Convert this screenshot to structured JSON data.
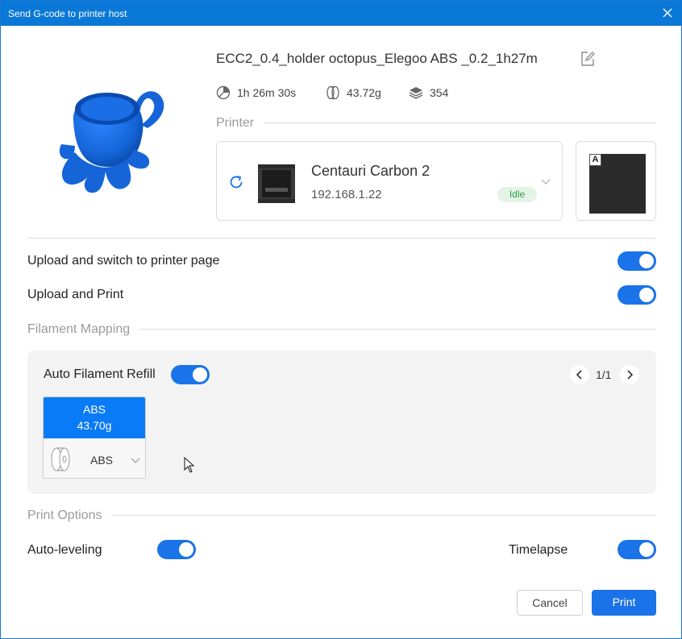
{
  "window": {
    "title": "Send G-code to printer host"
  },
  "file": {
    "name": "ECC2_0.4_holder octopus_Elegoo ABS _0.2_1h27m",
    "model_color": "#1565d8"
  },
  "stats": {
    "time": "1h 26m 30s",
    "weight": "43.72g",
    "layers": "354"
  },
  "printer_section": {
    "label": "Printer",
    "name": "Centauri Carbon 2",
    "ip": "192.168.1.22",
    "status": "Idle",
    "plate_badge": "A"
  },
  "options": {
    "upload_switch_label": "Upload and switch to printer page",
    "upload_switch_on": true,
    "upload_print_label": "Upload and Print",
    "upload_print_on": true
  },
  "filament_mapping": {
    "label": "Filament Mapping",
    "auto_refill_label": "Auto Filament Refill",
    "auto_refill_on": true,
    "page": "1/1",
    "slots": [
      {
        "name": "ABS",
        "weight": "43.70g",
        "mapped": "ABS",
        "color": "#0a7bf7"
      }
    ]
  },
  "print_options": {
    "label": "Print Options",
    "auto_leveling_label": "Auto-leveling",
    "auto_leveling_on": true,
    "timelapse_label": "Timelapse",
    "timelapse_on": true
  },
  "buttons": {
    "cancel": "Cancel",
    "print": "Print"
  },
  "colors": {
    "accent": "#1a73e8",
    "titlebar": "#0a78d7",
    "idle_badge_bg": "#e3f4e6",
    "idle_badge_text": "#2e9e49"
  }
}
